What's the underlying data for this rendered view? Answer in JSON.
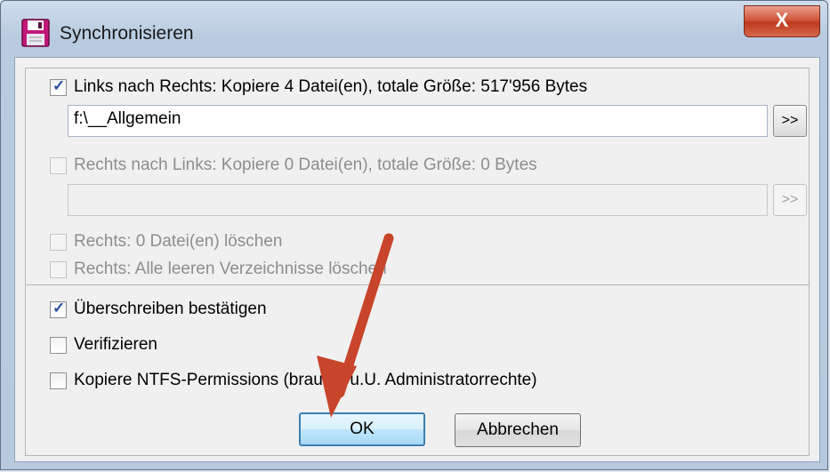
{
  "window": {
    "title": "Synchronisieren",
    "close_label": "X"
  },
  "options": {
    "left_to_right": {
      "label": "Links nach Rechts: Kopiere 4 Datei(en), totale Größe: 517'956 Bytes",
      "checked": true,
      "path": "f:\\__Allgemein"
    },
    "right_to_left": {
      "label": "Rechts nach Links: Kopiere 0 Datei(en), totale Größe: 0 Bytes",
      "checked": false,
      "path": ""
    },
    "delete_right": {
      "label": "Rechts: 0 Datei(en) löschen",
      "checked": false
    },
    "delete_empty_dirs": {
      "label": "Rechts: Alle leeren Verzeichnisse löschen",
      "checked": false
    },
    "confirm_overwrite": {
      "label": "Überschreiben bestätigen",
      "checked": true
    },
    "verify": {
      "label": "Verifizieren",
      "checked": false
    },
    "ntfs_permissions": {
      "label": "Kopiere NTFS-Permissions (braucht u.U. Administratorrechte)",
      "checked": false
    }
  },
  "browse_label": ">>",
  "buttons": {
    "ok": "OK",
    "cancel": "Abbrechen"
  },
  "colors": {
    "arrow": "#c8442a",
    "accent": "#3c7fb1"
  },
  "icons": {
    "app": "floppy-disk-icon",
    "check": "checkmark-icon"
  }
}
